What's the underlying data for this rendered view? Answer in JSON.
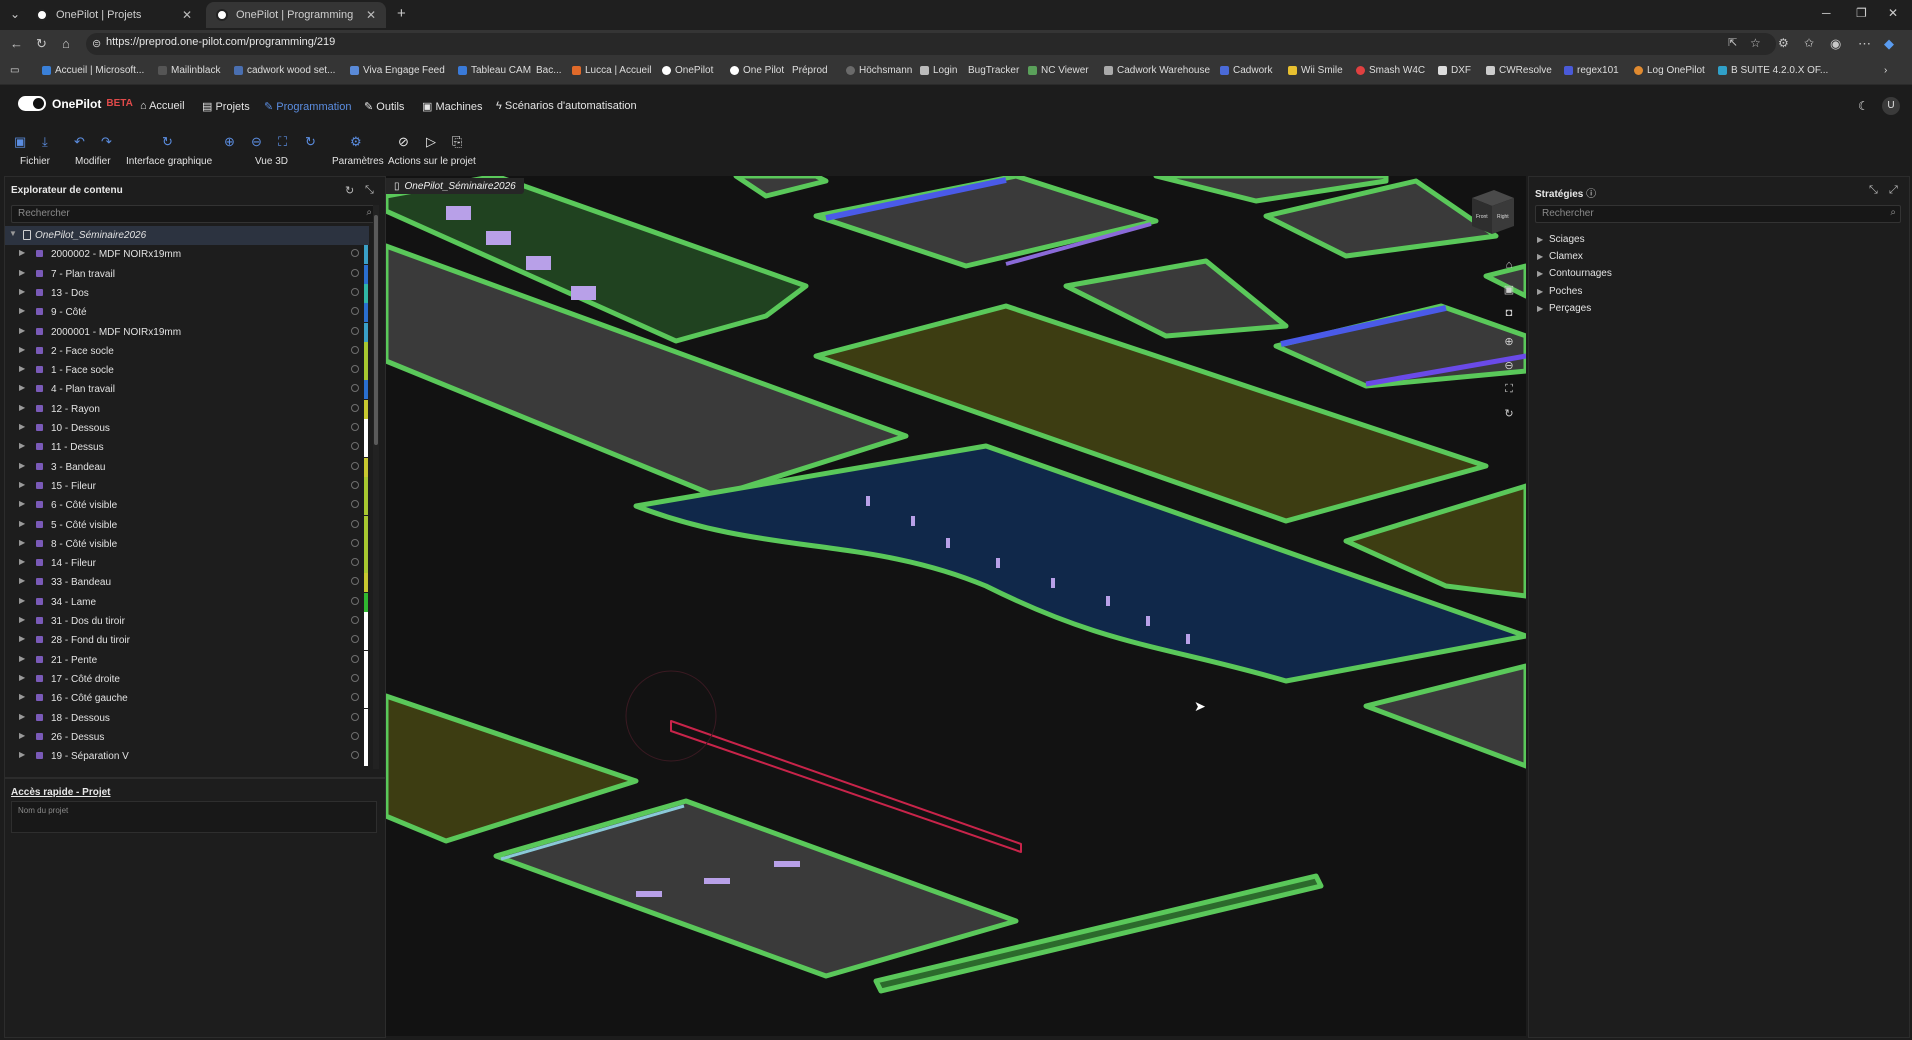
{
  "browser": {
    "tabs": [
      {
        "title": "OnePilot | Projets"
      },
      {
        "title": "OnePilot | Programming"
      }
    ],
    "url": "https://preprod.one-pilot.com/programming/219",
    "bookmarks": [
      "Accueil | Microsoft...",
      "Mailinblack",
      "cadwork wood set...",
      "Viva Engage",
      "Feed",
      "Tableau CAM",
      "Bac...",
      "Lucca | Accueil",
      "OnePilot",
      "One Pilot",
      "Préprod",
      "Höchsmann",
      "Login",
      "BugTracker",
      "NC Viewer",
      "Cadwork Warehouse",
      "Cadwork",
      "Wii Smile",
      "Smash W4C",
      "DXF",
      "CWResolve",
      "regex101",
      "Log OnePilot",
      "B SUITE 4.2.0.X OF..."
    ]
  },
  "app": {
    "brand": "OnePilot",
    "badge": "BETA",
    "nav": [
      "Accueil",
      "Projets",
      "Programmation",
      "Outils",
      "Machines",
      "Scénarios d'automatisation"
    ],
    "avatar": "U"
  },
  "toolbar": {
    "groups": [
      "Fichier",
      "Modifier",
      "Interface graphique",
      "Vue 3D",
      "Paramètres",
      "Actions sur le projet"
    ]
  },
  "explorer": {
    "title": "Explorateur de contenu",
    "search_placeholder": "Rechercher",
    "root": "OnePilot_Séminaire2026",
    "items": [
      {
        "label": "2000002 - MDF NOIRx19mm",
        "color": "#3aa0c8"
      },
      {
        "label": "7 - Plan travail",
        "color": "#2a6fd0"
      },
      {
        "label": "13 - Dos",
        "color": "#30b8a8"
      },
      {
        "label": "9 - Côté",
        "color": "#2a6fd0"
      },
      {
        "label": "2000001 - MDF NOIRx19mm",
        "color": "#3aa0c8"
      },
      {
        "label": "2 - Face socle",
        "color": "#a8c830"
      },
      {
        "label": "1 - Face socle",
        "color": "#a8c830"
      },
      {
        "label": "4 - Plan travail",
        "color": "#2a6fd0"
      },
      {
        "label": "12 - Rayon",
        "color": "#c8c830"
      },
      {
        "label": "10 - Dessous",
        "color": "#ffffff"
      },
      {
        "label": "11 - Dessus",
        "color": "#ffffff"
      },
      {
        "label": "3 - Bandeau",
        "color": "#c8c830"
      },
      {
        "label": "15 - Fileur",
        "color": "#a8c830"
      },
      {
        "label": "6 - Côté visible",
        "color": "#a8c830"
      },
      {
        "label": "5 - Côté visible",
        "color": "#a8c830"
      },
      {
        "label": "8 - Côté visible",
        "color": "#a8c830"
      },
      {
        "label": "14 - Fileur",
        "color": "#a8c830"
      },
      {
        "label": "33 - Bandeau",
        "color": "#c8c830"
      },
      {
        "label": "34 - Lame",
        "color": "#30b830"
      },
      {
        "label": "31 - Dos du tiroir",
        "color": "#ffffff"
      },
      {
        "label": "28 - Fond du tiroir",
        "color": "#ffffff"
      },
      {
        "label": "21 - Pente",
        "color": "#ffffff"
      },
      {
        "label": "17 - Côté droite",
        "color": "#ffffff"
      },
      {
        "label": "16 - Côté gauche",
        "color": "#ffffff"
      },
      {
        "label": "18 - Dessous",
        "color": "#ffffff"
      },
      {
        "label": "26 - Dessus",
        "color": "#ffffff"
      },
      {
        "label": "19 - Séparation V",
        "color": "#ffffff"
      }
    ]
  },
  "quick_access": {
    "title": "Accès rapide - Projet",
    "field_label": "Nom du projet"
  },
  "viewport": {
    "tab_label": "OnePilot_Séminaire2026",
    "cube_labels": [
      "Front",
      "Right"
    ]
  },
  "strategies": {
    "title": "Stratégies",
    "search_placeholder": "Rechercher",
    "items": [
      "Sciages",
      "Clamex",
      "Contournages",
      "Poches",
      "Perçages"
    ]
  }
}
